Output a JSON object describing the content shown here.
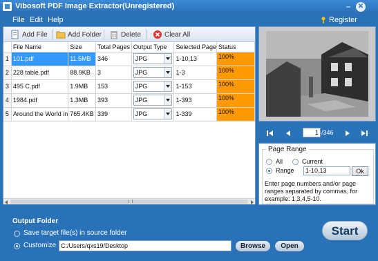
{
  "window": {
    "title": "Vibosoft PDF Image Extractor(Unregistered)",
    "minimize_glyph": "−",
    "close_glyph": "✕"
  },
  "menu": {
    "items": [
      "File",
      "Edit",
      "Help"
    ],
    "register_label": "Register"
  },
  "toolbar": {
    "add_file": "Add File",
    "add_folder": "Add Folder",
    "delete": "Delete",
    "clear_all": "Clear All"
  },
  "table": {
    "columns": [
      "File Name",
      "Size",
      "Total Pages",
      "Output Type",
      "Selected Page",
      "Status"
    ],
    "rows": [
      {
        "num": "1",
        "name": "101.pdf",
        "size": "11.5MB",
        "pages": "346",
        "type": "JPG",
        "selected": "1-10,13",
        "status": "100%"
      },
      {
        "num": "2",
        "name": "228 table.pdf",
        "size": "88.9KB",
        "pages": "3",
        "type": "JPG",
        "selected": "1-3",
        "status": "100%"
      },
      {
        "num": "3",
        "name": "495 C.pdf",
        "size": "1.9MB",
        "pages": "153",
        "type": "JPG",
        "selected": "1-153",
        "status": "100%"
      },
      {
        "num": "4",
        "name": "1984.pdf",
        "size": "1.3MB",
        "pages": "393",
        "type": "JPG",
        "selected": "1-393",
        "status": "100%"
      },
      {
        "num": "5",
        "name": "Around the World in",
        "size": "765.4KB",
        "pages": "339",
        "type": "JPG",
        "selected": "1-339",
        "status": "100%"
      }
    ],
    "selected_row": 0
  },
  "preview": {
    "current_page": "1",
    "total_pages": "/346"
  },
  "page_range": {
    "title": "Page Range",
    "all_label": "All",
    "current_label": "Current",
    "range_label": "Range",
    "selected_option": "range",
    "range_value": "1-10,13",
    "ok_label": "Ok",
    "hint": "Enter page numbers and/or page ranges separated by commas, for example: 1,3,4,5-10."
  },
  "output": {
    "title": "Output Folder",
    "source_label": "Save target file(s) in source folder",
    "customize_label": "Customize",
    "selected_option": "customize",
    "path": "C:/Users/qxs19/Desktop",
    "browse_label": "Browse",
    "open_label": "Open",
    "start_label": "Start"
  },
  "colors": {
    "chrome_blue": "#2a72b8",
    "status_orange": "#ff9a00",
    "selection_blue": "#3399ff"
  }
}
